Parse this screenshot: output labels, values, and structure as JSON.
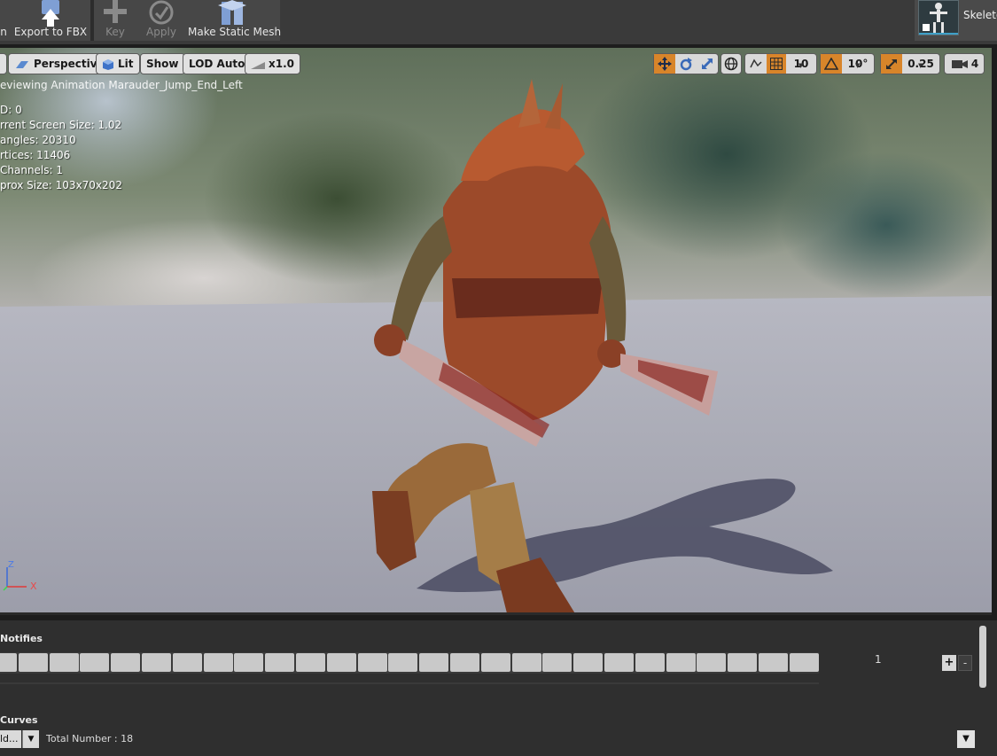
{
  "toolbar": {
    "first_partial_label": "n",
    "export_label": "Export to FBX",
    "key_label": "Key",
    "apply_label": "Apply",
    "make_static_label": "Make Static Mesh",
    "skeleton_tab_label": "Skeleto"
  },
  "viewport": {
    "perspective_label": "Perspective",
    "lit_label": "Lit",
    "show_label": "Show",
    "lod_label": "LOD Auto",
    "speed_label": "x1.0",
    "grid_snap_value": "10",
    "rotation_snap_value": "10°",
    "scale_snap_value": "0.25",
    "camera_speed_value": "4",
    "preview_text": "eviewing Animation Marauder_Jump_End_Left",
    "stats": [
      "D: 0",
      "rrent Screen Size: 1.02",
      "angles: 20310",
      "rtices: 11406",
      " Channels: 1",
      "prox Size: 103x70x202"
    ],
    "axis_z": "Z",
    "axis_x": "X"
  },
  "notifies": {
    "title": "Notifies",
    "frame_value": "1",
    "plus_label": "+",
    "minus_label": "-"
  },
  "curves": {
    "title": "Curves",
    "field_value": "ld...",
    "total_label": "Total Number : 18"
  },
  "colors": {
    "accent_orange": "#d8852a",
    "panel_bg": "#2f2f2f",
    "toolbar_bg": "#474747"
  }
}
